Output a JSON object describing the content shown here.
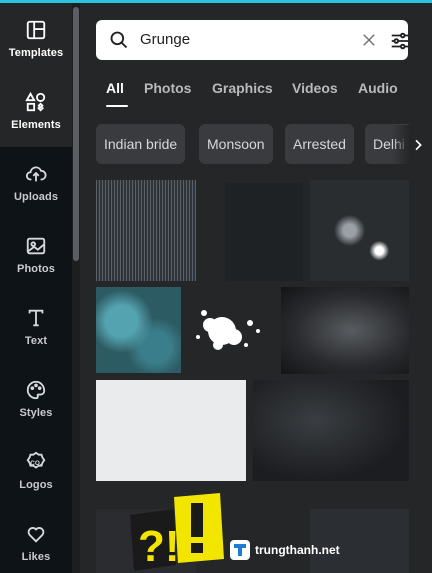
{
  "sidebar": {
    "items": [
      {
        "label": "Templates",
        "icon": "templates-icon"
      },
      {
        "label": "Elements",
        "icon": "elements-icon"
      },
      {
        "label": "Uploads",
        "icon": "upload-cloud-icon"
      },
      {
        "label": "Photos",
        "icon": "photo-icon"
      },
      {
        "label": "Text",
        "icon": "text-icon"
      },
      {
        "label": "Styles",
        "icon": "palette-icon"
      },
      {
        "label": "Logos",
        "icon": "logo-co-icon"
      },
      {
        "label": "Likes",
        "icon": "heart-icon"
      }
    ]
  },
  "search": {
    "value": "Grunge"
  },
  "tabs": [
    "All",
    "Photos",
    "Graphics",
    "Videos",
    "Audio"
  ],
  "chips": [
    "Indian bride",
    "Monsoon",
    "Arrested",
    "Delhi"
  ],
  "sticker_text": "?!",
  "watermark": "trungthanh.net",
  "colors": {
    "accent": "#27c3df",
    "sidebar_bg": "#0e1318",
    "panel_bg": "#252627",
    "chip_bg": "#393b3e"
  }
}
